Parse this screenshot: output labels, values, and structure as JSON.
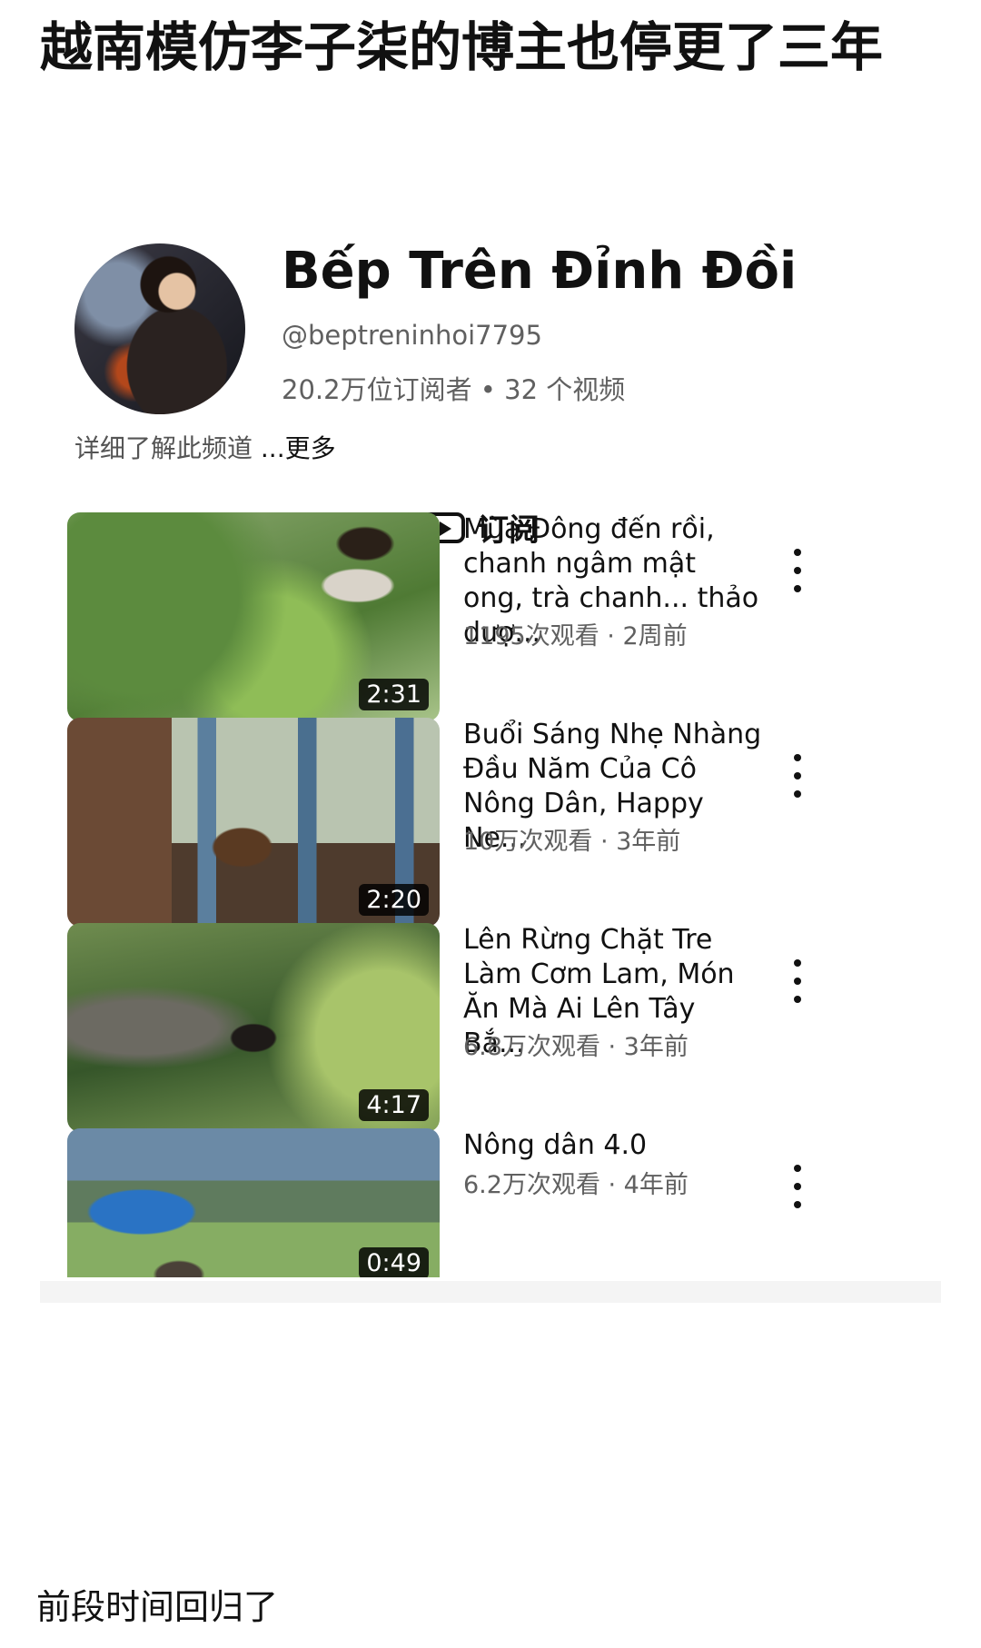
{
  "post": {
    "title": "越南模仿李子柒的博主也停更了三年",
    "caption": "前段时间回归了"
  },
  "channel": {
    "name": "Bếp Trên Đỉnh Đồi",
    "handle": "@beptreninhoi7795",
    "stats": "20.2万位订阅者 • 32 个视频",
    "about": "详细了解此频道 ",
    "about_more": "...更多",
    "subscribe_label": "订阅",
    "subscribe_icon": "youtube-play-icon"
  },
  "videos": [
    {
      "title": "Mùa Đông đến rồi, chanh ngâm mật ong, trà chanh... thảo dượ...",
      "meta": "1195次观看 · 2周前",
      "duration": "2:31"
    },
    {
      "title": "Buổi Sáng Nhẹ Nhàng Đầu Năm Của Cô Nông Dân, Happy Ne...",
      "meta": "10万次观看 · 3年前",
      "duration": "2:20"
    },
    {
      "title": "Lên Rừng Chặt Tre Làm Cơm Lam, Món Ăn Mà Ai Lên Tây Bắ...",
      "meta": "6.8万次观看 · 3年前",
      "duration": "4:17"
    },
    {
      "title": "Nông dân 4.0",
      "meta": "6.2万次观看 · 4年前",
      "duration": "0:49"
    }
  ]
}
